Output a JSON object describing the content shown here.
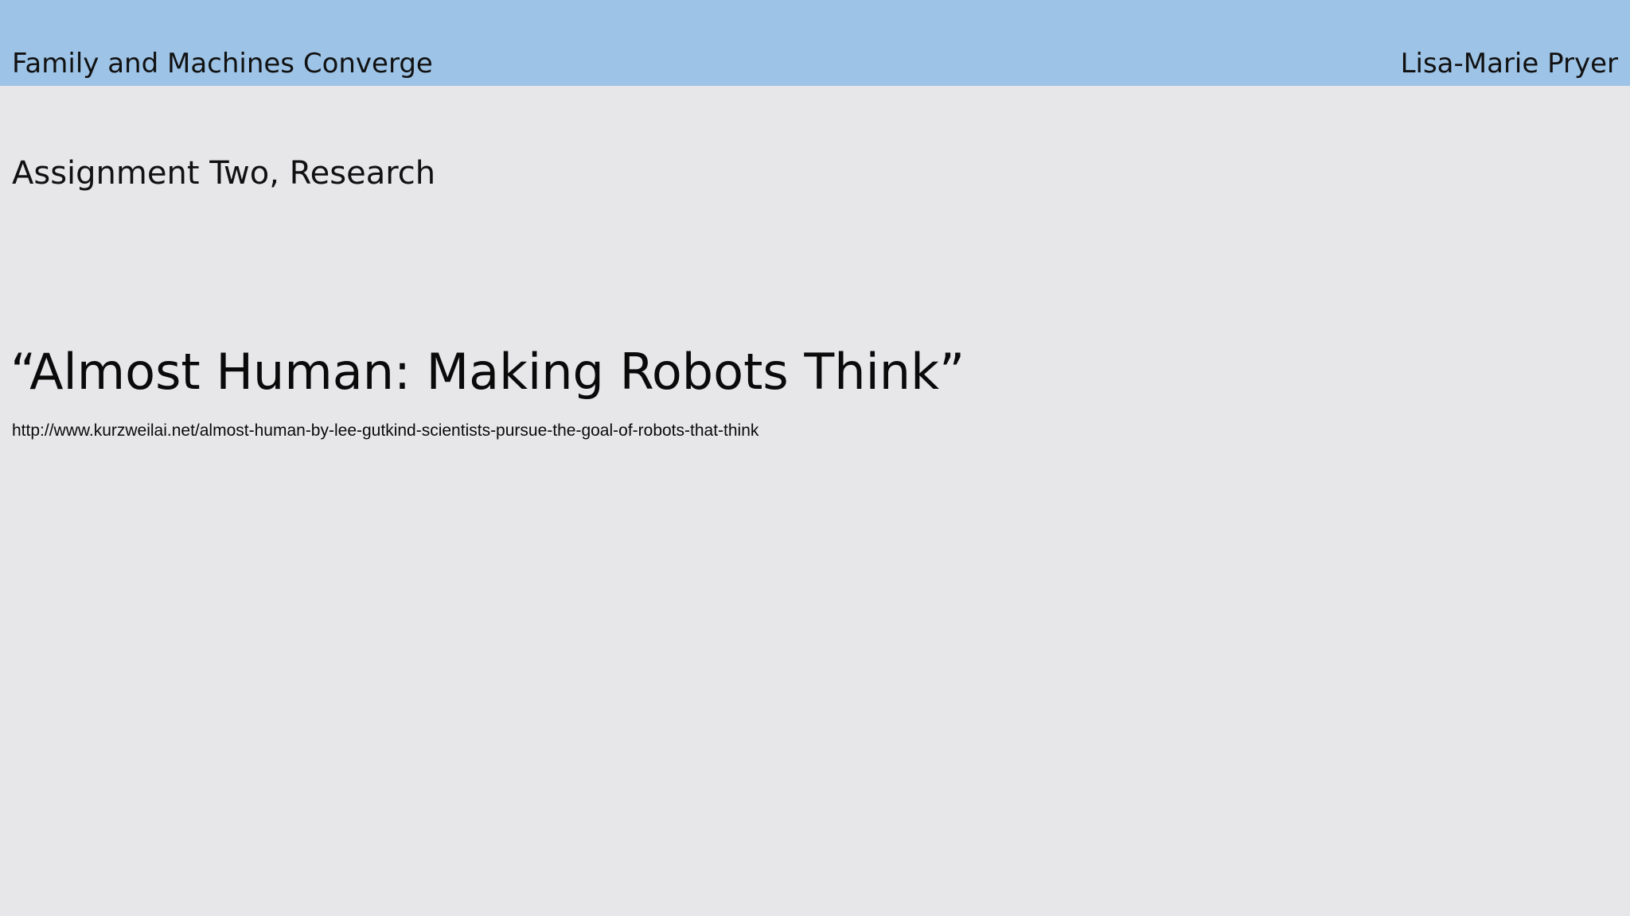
{
  "header": {
    "title": "Family and Machines Converge",
    "author": "Lisa-Marie Pryer"
  },
  "slide": {
    "subtitle": "Assignment Two, Research",
    "article_title": "“Almost Human: Making Robots Think”",
    "source_url": "http://www.kurzweilai.net/almost-human-by-lee-gutkind-scientists-pursue-the-goal-of-robots-that-think"
  },
  "colors": {
    "header_background": "#9dc3e6",
    "page_background": "#e7e6e9",
    "text": "#111111"
  }
}
